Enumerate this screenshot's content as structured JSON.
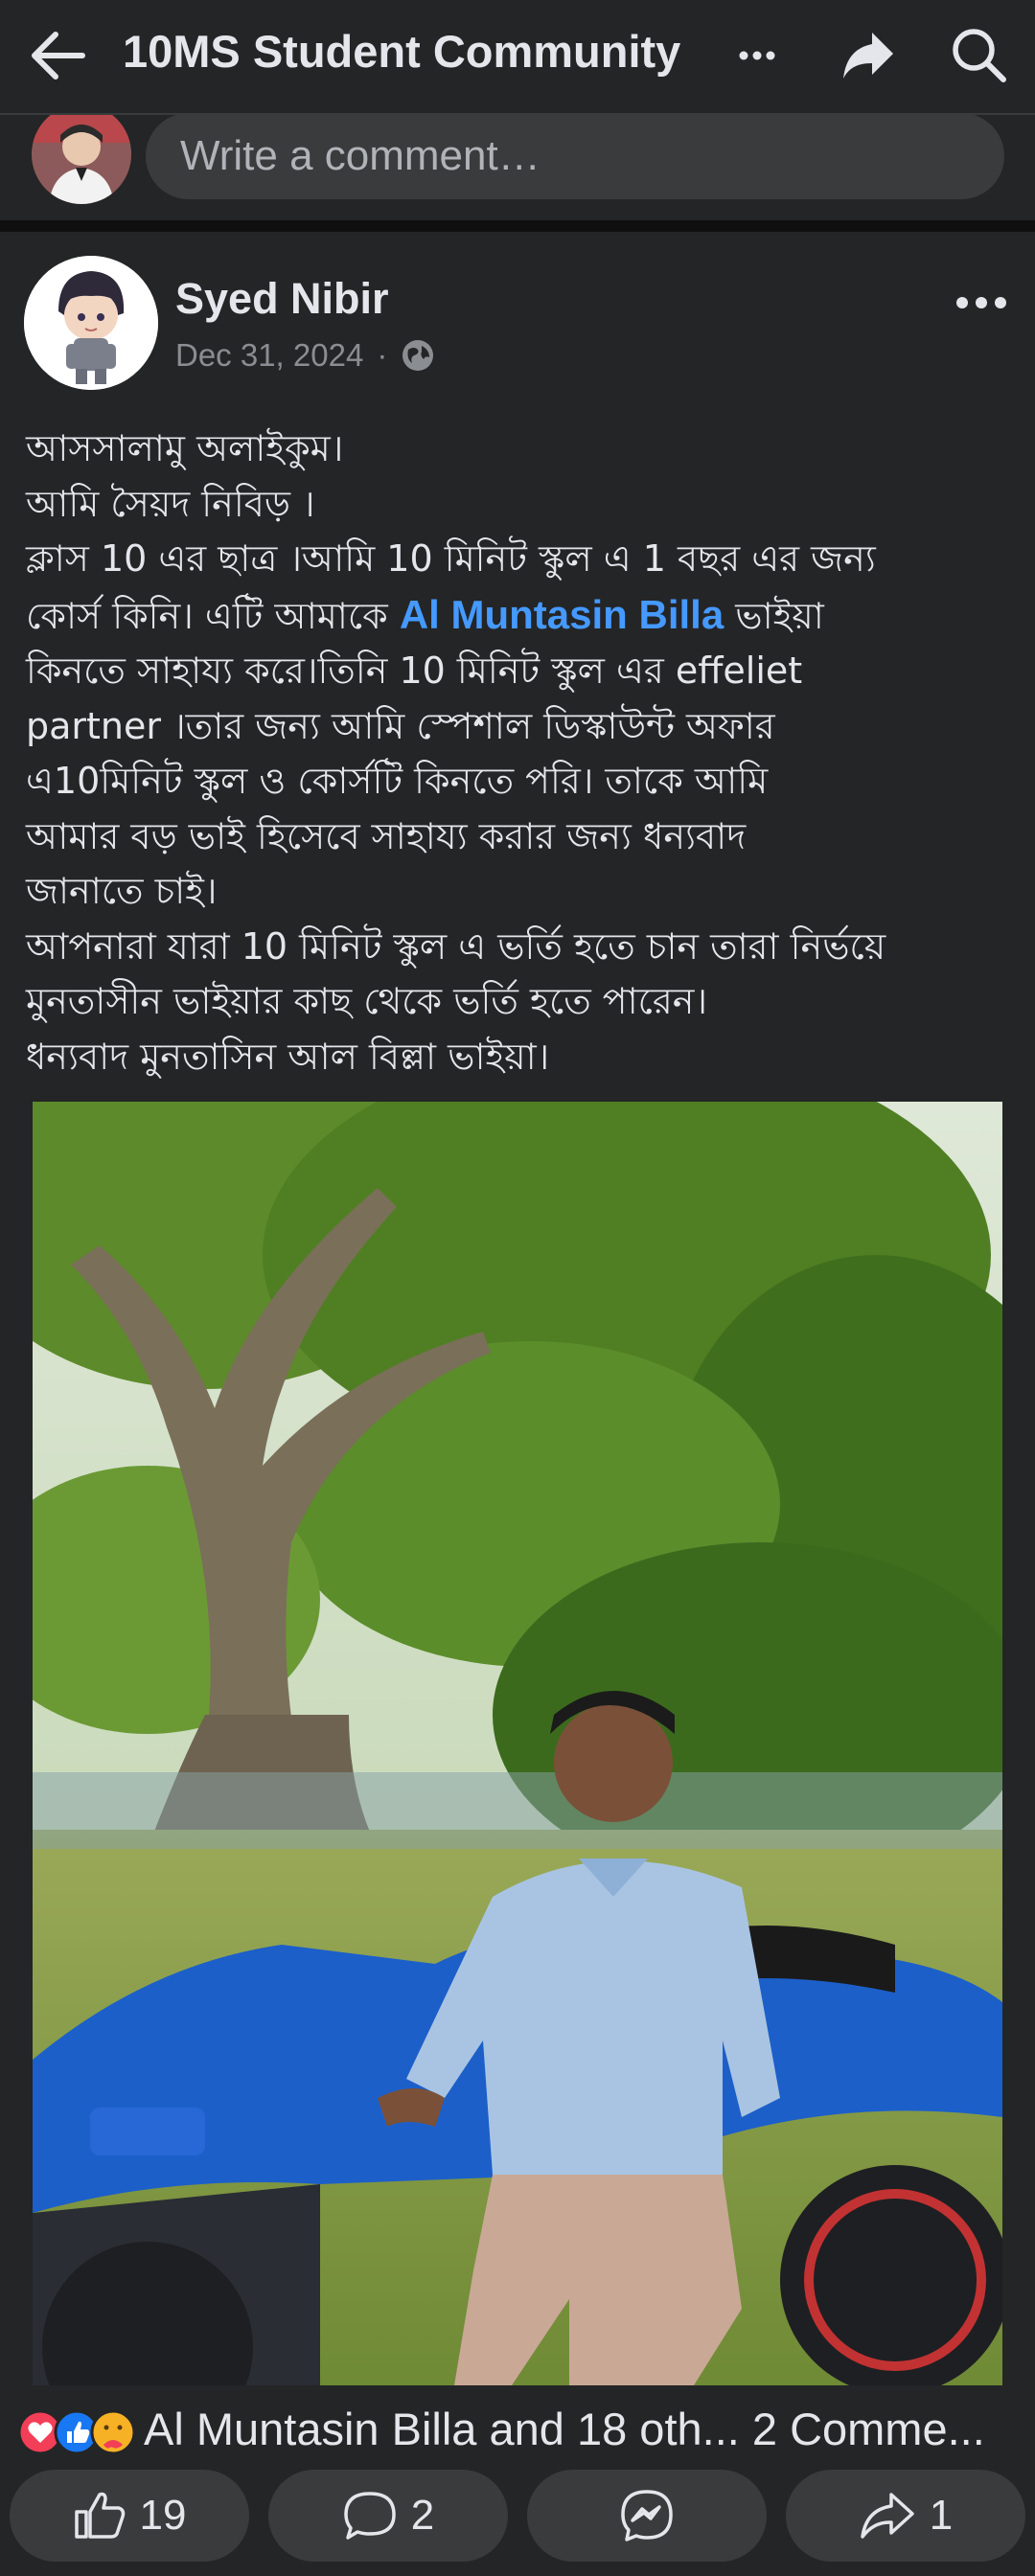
{
  "header": {
    "title": "10MS Student Community",
    "back_icon": "arrow-left-icon",
    "more_icon": "ellipsis-icon",
    "share_icon": "share-arrow-icon",
    "search_icon": "search-icon"
  },
  "comment_box": {
    "placeholder": "Write a comment…"
  },
  "post": {
    "author": "Syed Nibir",
    "date": "Dec 31, 2024",
    "separator": "·",
    "audience_icon": "globe-icon",
    "text_lines": [
      "আসসালামু অলাইকুম।",
      "আমি সৈয়দ নিবিড় ।",
      "ক্লাস 10 এর ছাত্র ।আমি 10 মিনিট স্কুল এ 1 বছর এর জন্য",
      {
        "before": "কোর্স কিনি। এটি আমাকে ",
        "mention": "Al Muntasin Billa",
        "after": " ভাইয়া"
      },
      "কিনতে সাহায্য করে।তিনি 10 মিনিট স্কুল এর effeliet",
      "partner ।তার জন্য আমি স্পেশাল ডিস্কাউন্ট অফার",
      "এ10মিনিট স্কুল ও কোর্সটি কিনতে পরি। তাকে আমি",
      "আমার  বড় ভাই হিসেবে সাহায্য করার জন্য ধন্যবাদ",
      "জানাতে চাই।",
      "আপনারা যারা 10 মিনিট স্কুল এ ভর্তি হতে চান তারা নির্ভয়ে",
      "মুনতাসীন ভাইয়ার কাছ থেকে ভর্তি হতে পারেন।",
      "ধন্যবাদ মুনতাসিন আল বিল্লা ভাইয়া।"
    ]
  },
  "reactions": {
    "summary": "Al Muntasin Billa and 18 oth... 2 Comme...",
    "icons": [
      "love-reaction-icon",
      "like-reaction-icon",
      "care-reaction-icon"
    ]
  },
  "actions": {
    "like_count": "19",
    "comment_count": "2",
    "share_count": "1"
  },
  "colors": {
    "background": "#242526",
    "mention": "#4599ff",
    "button_bg": "#3a3b3c"
  }
}
